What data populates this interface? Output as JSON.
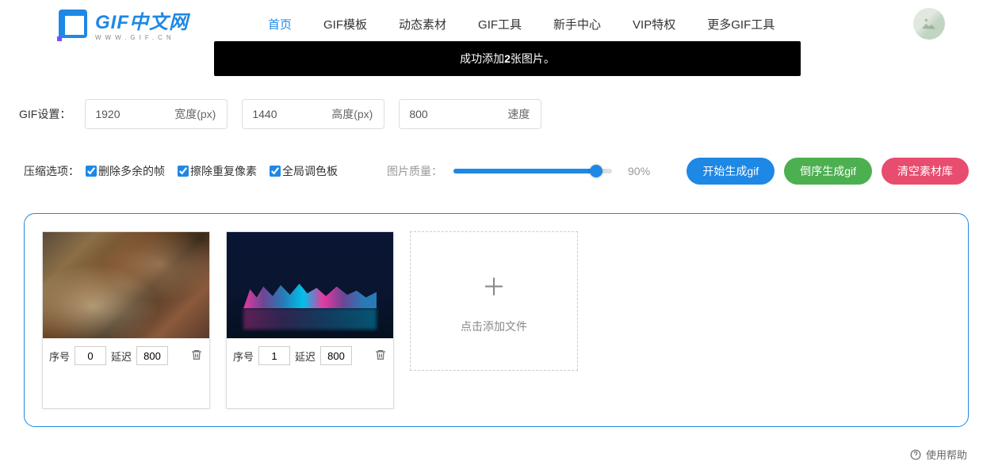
{
  "logo": {
    "main": "GIF中文网",
    "sub": "WWW.GIF.CN"
  },
  "nav": [
    "首页",
    "GIF模板",
    "动态素材",
    "GIF工具",
    "新手中心",
    "VIP特权",
    "更多GIF工具"
  ],
  "toast": {
    "prefix": "成功添加",
    "count": "2",
    "suffix": "张图片。"
  },
  "settings": {
    "label": "GIF设置：",
    "width": {
      "value": "1920",
      "suffix": "宽度(px)"
    },
    "height": {
      "value": "1440",
      "suffix": "高度(px)"
    },
    "speed": {
      "value": "800",
      "suffix": "速度"
    }
  },
  "compress": {
    "label": "压缩选项：",
    "items": [
      "删除多余的帧",
      "擦除重复像素",
      "全局调色板"
    ]
  },
  "quality": {
    "label": "图片质量：",
    "value": "90%"
  },
  "buttons": {
    "start": "开始生成gif",
    "reverse": "倒序生成gif",
    "clear": "清空素材库"
  },
  "cards": [
    {
      "seqLabel": "序号",
      "seq": "0",
      "delayLabel": "延迟",
      "delay": "800"
    },
    {
      "seqLabel": "序号",
      "seq": "1",
      "delayLabel": "延迟",
      "delay": "800"
    }
  ],
  "addCard": "点击添加文件",
  "help": "使用帮助"
}
